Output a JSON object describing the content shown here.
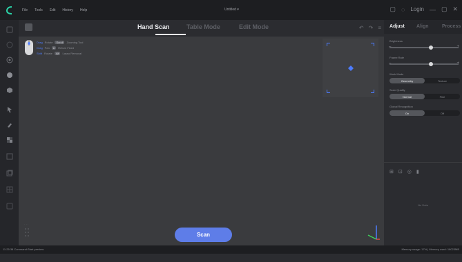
{
  "menubar": {
    "menus": [
      "File",
      "Tools",
      "Edit",
      "History",
      "Help"
    ],
    "document_title": "Untitled ▾",
    "login_label": "Login"
  },
  "mode_tabs": [
    {
      "label": "Hand Scan",
      "active": true
    },
    {
      "label": "Table Mode",
      "active": false
    },
    {
      "label": "Edit Mode",
      "active": false
    }
  ],
  "mouse_hints": [
    {
      "key": "Drag",
      "desc": "Rotate",
      "extra": "Scroll",
      "extra_desc": "Zooming Tool"
    },
    {
      "key": "Drag",
      "desc": "Pan",
      "extra": "●",
      "extra_desc": "Return Fixed"
    },
    {
      "key": "Shift",
      "desc": "Rotate",
      "extra": "Alt",
      "extra_desc": "Lasso Removal"
    }
  ],
  "scan_button": {
    "label": "Scan"
  },
  "right_panel": {
    "tabs": [
      {
        "label": "Adjust",
        "active": true
      },
      {
        "label": "Align",
        "active": false
      },
      {
        "label": "Process",
        "active": false
      }
    ],
    "brightness": {
      "label": "Brightness",
      "level": 0.6
    },
    "frame_rate": {
      "label": "Frame Rate",
      "level": 0.6
    },
    "work_mode": {
      "label": "Work Mode",
      "options": [
        "Geometry",
        "Texture"
      ],
      "selected": 0
    },
    "scan_quality": {
      "label": "Scan Quality",
      "options": [
        "Normal",
        "Fine"
      ],
      "selected": 0
    },
    "global_recognition": {
      "label": "Global Recognition",
      "options": [
        "On",
        "Off"
      ],
      "selected": 0
    },
    "empty_text": "No Data"
  },
  "statusbar": {
    "left_text": "11:25:38 Command:Start preview",
    "right_text": "Memory usage: 17% | Memory used: 18023MB"
  },
  "colors": {
    "accent": "#4d7cff",
    "scan_button": "#5e7de8",
    "background": "#3a3b3e"
  },
  "icons": {
    "left_toolbar": [
      "new-project-icon",
      "open-icon",
      "select-icon",
      "light-icon",
      "cube-icon",
      "pointer-icon",
      "brush-icon",
      "checker-icon",
      "box-icon",
      "layers-icon",
      "grid-icon",
      "measure-icon"
    ]
  }
}
